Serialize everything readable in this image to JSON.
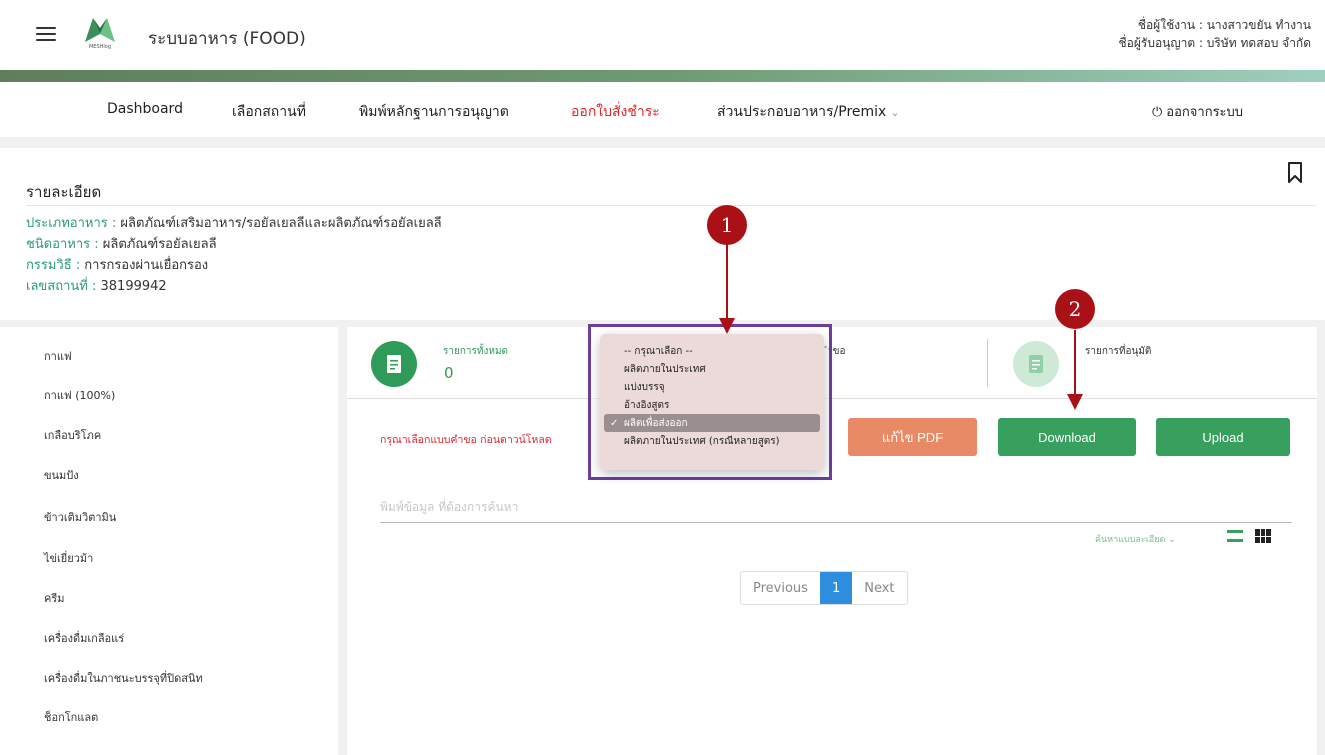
{
  "header": {
    "app_title": "ระบบอาหาร (FOOD)",
    "logo_text": "MESHlog",
    "user_line": "ชื่อผู้ใช้งาน : นางสาวขยัน ทำงาน",
    "licensee_line": "ชื่อผู้รับอนุญาต : บริษัท ทดสอบ จำกัด"
  },
  "nav": {
    "items": [
      {
        "label": "Dashboard"
      },
      {
        "label": "เลือกสถานที่"
      },
      {
        "label": "พิมพ์หลักฐานการอนุญาต"
      },
      {
        "label": "ออกใบสั่งชำระ"
      },
      {
        "label": "ส่วนประกอบอาหาร/Premix"
      }
    ],
    "chevron": "⌄",
    "logout_label": "ออกจากระบบ",
    "power_glyph": "⏻"
  },
  "details": {
    "title": "รายละเอียด",
    "rows": [
      {
        "label": "ประเภทอาหาร :",
        "value": " ผลิตภัณฑ์เสริมอาหาร/รอยัลเยลลีและผลิตภัณฑ์รอยัลเยลลี"
      },
      {
        "label": "ชนิดอาหาร :",
        "value": " ผลิตภัณฑ์รอยัลเยลลี"
      },
      {
        "label": "กรรมวิธี :",
        "value": " การกรองผ่านเยื่อกรอง"
      },
      {
        "label": "เลขสถานที่ :",
        "value": " 38199942"
      }
    ]
  },
  "sidebar": {
    "items": [
      {
        "label": "กาแฟ"
      },
      {
        "label": "กาแฟ (100%)"
      },
      {
        "label": "เกลือบริโภค"
      },
      {
        "label": "ขนมปัง"
      },
      {
        "label": "ข้าวเติมวิตามิน"
      },
      {
        "label": "ไข่เยี่ยวม้า"
      },
      {
        "label": "ครีม"
      },
      {
        "label": "เครื่องดื่มเกลือแร่"
      },
      {
        "label": "เครื่องดื่มในภาชนะบรรจุที่ปิดสนิท"
      },
      {
        "label": "ช็อกโกแลต"
      }
    ]
  },
  "stats": {
    "total_label": "รายการทั้งหมด",
    "total_value": "0",
    "request_label_partial": "ำขอ",
    "approved_label": "รายการที่อนุมัติ"
  },
  "actions": {
    "hint": "กรุณาเลือกแบบคำขอ ก่อนดาวน์โหลด",
    "edit_pdf": "แก้ไข PDF",
    "download": "Download",
    "upload": "Upload"
  },
  "search": {
    "placeholder": "พิมพ์ข้อมูล ที่ต้องการค้นหา",
    "advanced_label": "ค้นหาแบบละเอียด ⌄"
  },
  "pagination": {
    "previous": "Previous",
    "current": "1",
    "next": "Next"
  },
  "dropdown": {
    "options": [
      {
        "label": "-- กรุณาเลือก --"
      },
      {
        "label": "ผลิตภายในประเทศ"
      },
      {
        "label": "แบ่งบรรจุ"
      },
      {
        "label": "อ้างอิงสูตร"
      },
      {
        "label": "ผลิตเพื่อส่งออก"
      },
      {
        "label": "ผลิตภายในประเทศ (กรณีหลายสูตร)"
      }
    ],
    "selected": "ผลิตเพื่อส่งออก",
    "check": "✓"
  },
  "annotations": {
    "marker_1": "1",
    "marker_2": "2"
  },
  "colors": {
    "accent_green": "#37a05f",
    "active_red": "#e0262b",
    "annotation_red": "#aa1117",
    "highlight_purple": "#6b3fa0"
  }
}
